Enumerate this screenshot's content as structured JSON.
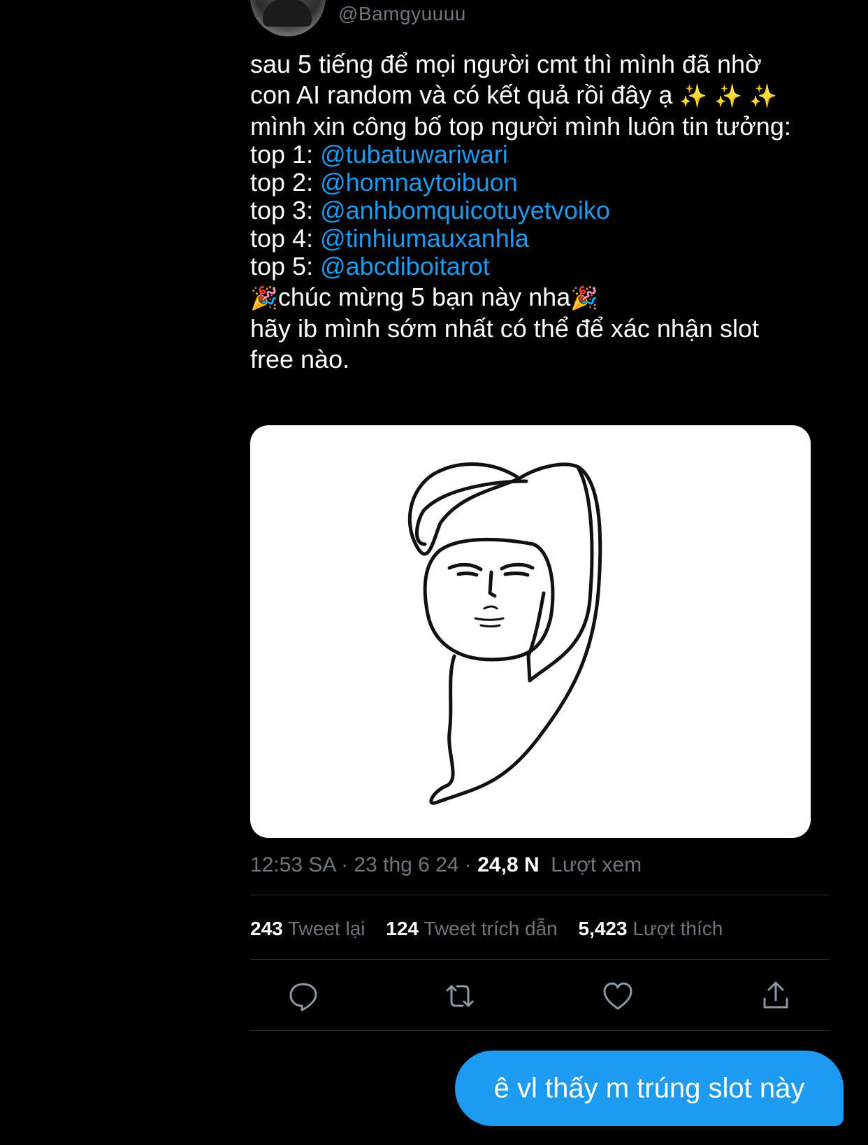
{
  "header": {
    "handle": "@Bamgyuuuu"
  },
  "tweet": {
    "line1": "sau 5 tiếng để mọi người cmt thì mình đã nhờ",
    "line2_text": "con AI random và có kết quả rồi đây ạ ",
    "line2_emoji": "✨ ✨ ✨",
    "line3": "mình xin công bố top người mình luôn tin tưởng:",
    "tops": [
      {
        "label": "top 1: ",
        "mention": "@tubatuwariwari"
      },
      {
        "label": "top 2: ",
        "mention": "@homnaytoibuon"
      },
      {
        "label": "top 3: ",
        "mention": "@anhbomquicotuyetvoiko"
      },
      {
        "label": "top 4: ",
        "mention": "@tinhiumauxanhla"
      },
      {
        "label": "top 5: ",
        "mention": "@abcdiboitarot"
      }
    ],
    "congrats_emoji_left": "🎉",
    "congrats_text": "chúc mừng 5 bạn này nha",
    "congrats_emoji_right": "🎉",
    "line_ib": "hãy ib mình sớm nhất có thể để xác nhận slot",
    "line_free": "free nào."
  },
  "meta": {
    "time": "12:53 SA · 23 thg 6 24 · ",
    "views_count": "24,8 N",
    "views_label": "Lượt xem"
  },
  "stats": {
    "retweets_count": "243",
    "retweets_label": "Tweet lại",
    "quotes_count": "124",
    "quotes_label": "Tweet trích dẫn",
    "likes_count": "5,423",
    "likes_label": "Lượt thích"
  },
  "actions": {
    "reply_icon": "reply-icon",
    "retweet_icon": "retweet-icon",
    "like_icon": "heart-icon",
    "share_icon": "share-icon"
  },
  "message": {
    "text": "ê vl thấy m trúng slot này"
  },
  "colors": {
    "background": "#000000",
    "mention": "#1d9bf0",
    "muted": "#6e767d",
    "divider": "#2f3336",
    "bubble": "#1d9bf0"
  }
}
